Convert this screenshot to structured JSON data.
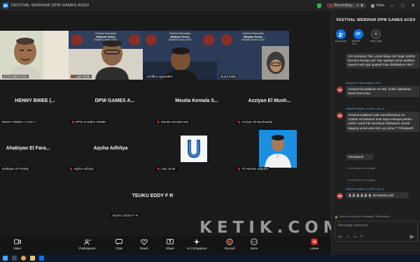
{
  "window": {
    "title": "FESTIVAL WEBINAR DPW GAMES ACEH",
    "recording": "Recording...",
    "view": "View"
  },
  "top_strip": [
    {
      "name": "E FOUNDATION",
      "muted": false
    },
    {
      "name": "Lan Umar",
      "muted": true,
      "banner": "Festival Ramadan",
      "banner2": "Webinar Series"
    },
    {
      "name": "Achfikra Agussalim",
      "muted": false
    },
    {
      "name": "Nurul Anita",
      "muted": false
    }
  ],
  "banner": {
    "line1": "Festival Ramadan",
    "line2": "Webinar Series",
    "line3": "GAMES Aceh 2025"
  },
  "grid": [
    {
      "display": "HENNY BWEE (...",
      "label": "HENNY BWEE ( ACEH )"
    },
    {
      "display": "DPW GAMES A...",
      "label": "DPW GAMES ADMIN"
    },
    {
      "display": "Meutia Kemala S...",
      "label": "Meutia Kemala Sari"
    },
    {
      "display": "Azziyan El Mush...",
      "label": "Azziyan El Mushaddiq"
    },
    {
      "display": "Ahabiyan El Fara...",
      "label": "Ahabiyan El Faraby"
    },
    {
      "display": "Aqsha Adhitya",
      "label": "Aqsha Adhitya"
    },
    {
      "display": "",
      "label": "Lain Umar"
    },
    {
      "display": "",
      "label": "Tri Hendra Saputra"
    },
    {
      "display": "TEUKU EDDY F R",
      "label": "TEUKU EDDY F R"
    }
  ],
  "toolbar": {
    "video": "Video",
    "participants": "Participants",
    "participants_count": "13",
    "chat": "Chat",
    "react": "React",
    "share": "Share",
    "ai": "AI Companion",
    "record": "Record",
    "more": "More",
    "leave": "Leave"
  },
  "chat": {
    "title": "FESTIVAL WEBINAR DPW GAMES ACEH",
    "tabs": [
      {
        "label": "Everyone",
        "initials": "",
        "color": "#0e72ed"
      },
      {
        "label": "EDDIE F.G...",
        "initials": "EF",
        "color": "#0e72ed"
      },
      {
        "label": "New chat",
        "initials": "+",
        "color": "#333333"
      }
    ],
    "messages": [
      {
        "who": "",
        "avatar": "",
        "avatar_color": "#b23c3c",
        "text": "Izin bertanya Pak, untuk biaya HKI bagi UMKM kira-kira berapa ya? dan apakah untuk aplikasi seperti web app apakah bisa didaftarkan HKI?"
      },
      {
        "who": "Azziyan El Mushaddiq 16.33",
        "avatar": "AE",
        "avatar_color": "#b23c3c",
        "text": "Assalamimualaikum wr Wb, boleh dijelaskan bisnis franchise,"
      },
      {
        "who": "HENNY BWEE ( ACEH ) 16.34",
        "avatar": "HB",
        "avatar_color": "#b23c3c",
        "text": "Assalamualaikum pak maunbertanya ne\nApalah ad batasan buat saya sebagai pelaku umkm untuk hki membuat /daftarkan  merek dagang untuk satu item yg sama ? Trimakasih"
      },
      {
        "who": "",
        "avatar": "",
        "avatar_color": "#b23c3c",
        "text": "Trimakasih"
      },
      {
        "who": "",
        "avatar": "",
        "avatar_color": "",
        "text": "You deleted a message"
      },
      {
        "who": "",
        "avatar": "",
        "avatar_color": "",
        "text": "You deleted a message"
      },
      {
        "who": "HENNY BWEE ( ACEH ) 16.37",
        "avatar": "HB",
        "avatar_color": "#b23c3c",
        "text": "🙏🏻🙏🏻🙏🏻🙏🏻🙏🏻🙏🏻 trimakasih pak"
      }
    ],
    "who_can_see": "Who can see your messages? Recording o...",
    "input_placeholder": "Message everyone"
  },
  "watermark": "KETIK.COM"
}
